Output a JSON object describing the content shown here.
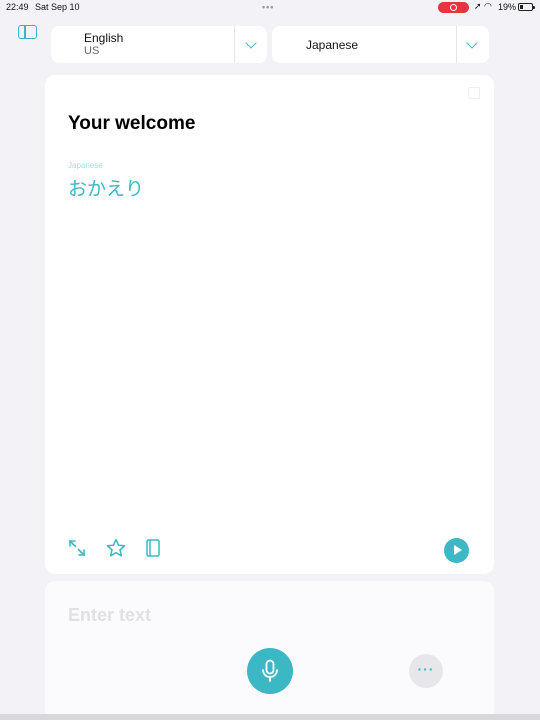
{
  "status_bar": {
    "time": "22:49",
    "date": "Sat Sep 10",
    "battery_percent": "19%",
    "battery_level": 0.19
  },
  "languages": {
    "source": {
      "name": "English",
      "region": "US"
    },
    "target": {
      "name": "Japanese"
    }
  },
  "translation": {
    "source_text": "Your welcome",
    "target_label": "Japanese",
    "translated_text": "おかえり"
  },
  "input": {
    "placeholder": "Enter text"
  },
  "colors": {
    "accent": "#3bb8c3",
    "background": "#f2f2f7",
    "recording": "#e8343c"
  },
  "icons": {
    "sidebar": "sidebar-icon",
    "expand": "expand-icon",
    "favorite": "star-icon",
    "dictionary": "book-icon",
    "play": "play-icon",
    "microphone": "microphone-icon",
    "more": "more-icon"
  }
}
